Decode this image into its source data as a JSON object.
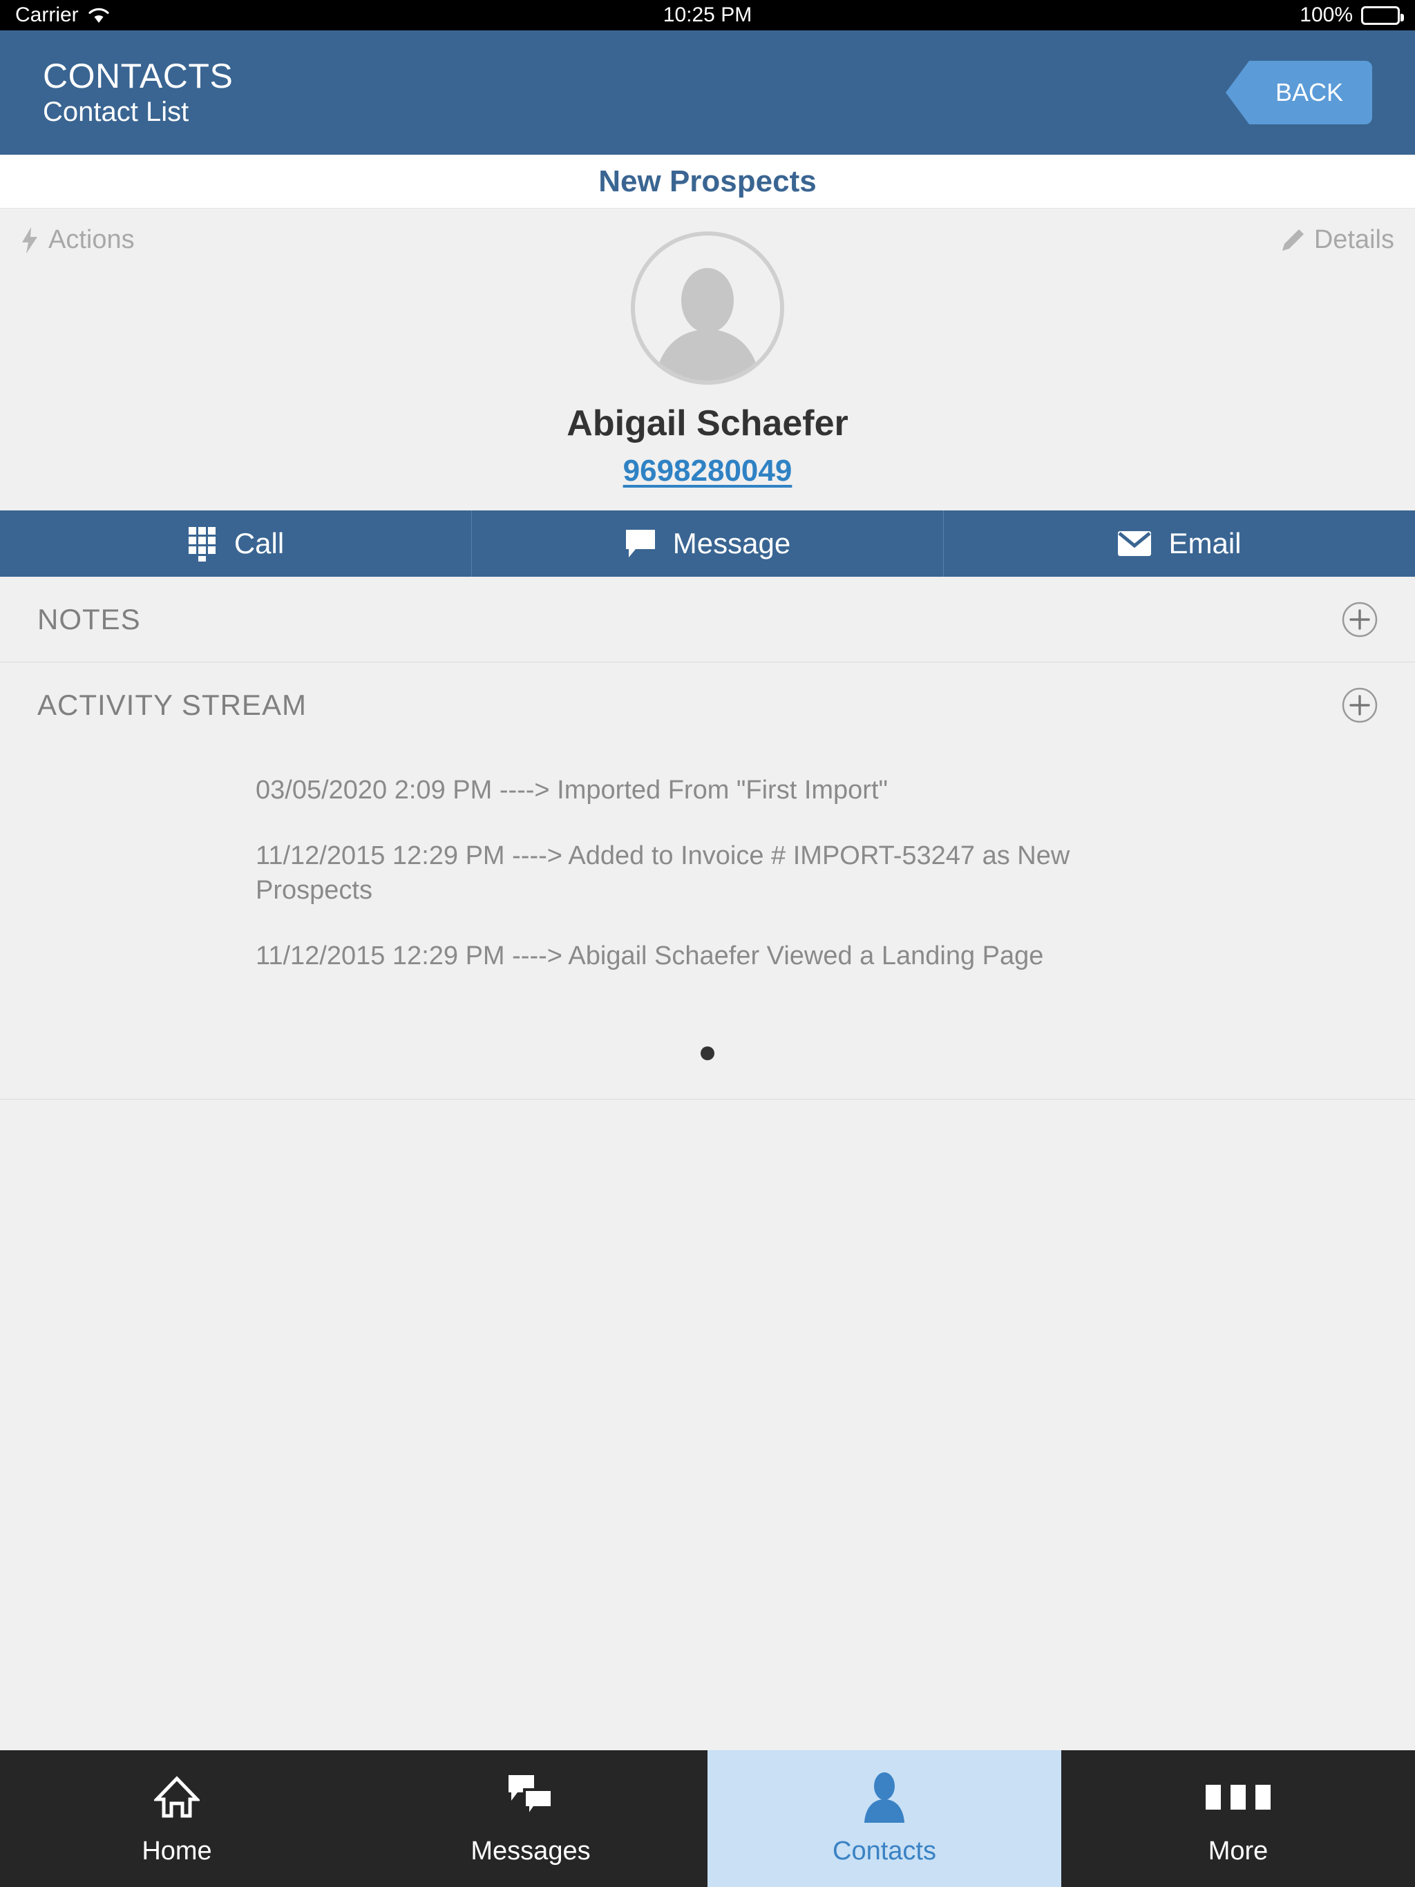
{
  "status_bar": {
    "carrier": "Carrier",
    "time": "10:25 PM",
    "battery_text": "100%",
    "wifi_icon": "wifi-icon",
    "battery_icon": "battery-icon"
  },
  "nav": {
    "title": "CONTACTS",
    "subtitle": "Contact List",
    "back_label": "BACK"
  },
  "list_title": "New Prospects",
  "contact_card": {
    "actions_label": "Actions",
    "actions_icon": "lightning-bolt-icon",
    "details_label": "Details",
    "details_icon": "pencil-icon",
    "avatar_icon": "person-placeholder-avatar",
    "name": "Abigail Schaefer",
    "phone": "9698280049"
  },
  "action_buttons": [
    {
      "label": "Call",
      "icon": "dialpad-icon"
    },
    {
      "label": "Message",
      "icon": "speech-bubble-icon"
    },
    {
      "label": "Email",
      "icon": "envelope-icon"
    }
  ],
  "notes_section": {
    "title": "NOTES",
    "add_icon": "plus-circle-icon"
  },
  "activity_section": {
    "title": "ACTIVITY STREAM",
    "add_icon": "plus-circle-icon",
    "items": [
      "03/05/2020 2:09 PM ----> Imported From \"First Import\"",
      "11/12/2015 12:29 PM ----> Added to Invoice # IMPORT-53247 as New Prospects",
      "11/12/2015 12:29 PM ----> Abigail Schaefer Viewed a Landing Page"
    ],
    "page_dots": 1
  },
  "tabs": [
    {
      "label": "Home",
      "icon": "home-icon",
      "active": false
    },
    {
      "label": "Messages",
      "icon": "messages-icon",
      "active": false
    },
    {
      "label": "Contacts",
      "icon": "contacts-person-icon",
      "active": true
    },
    {
      "label": "More",
      "icon": "more-dots-icon",
      "active": false
    }
  ],
  "colors": {
    "header_blue": "#3a6592",
    "back_blue": "#5b9bd8",
    "link_blue": "#2f82c4",
    "active_tab_bg": "#c9e0f5",
    "tabbar_bg": "#262626",
    "page_bg": "#f0f0f0"
  }
}
